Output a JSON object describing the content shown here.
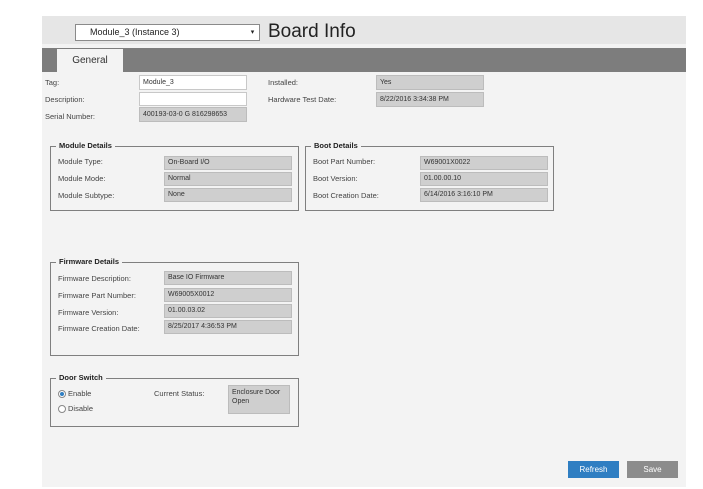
{
  "header": {
    "module_select_value": "Module_3 (Instance 3)",
    "title": "Board Info"
  },
  "tabs": [
    {
      "label": "General",
      "active": true
    }
  ],
  "general": {
    "tag_label": "Tag:",
    "tag_value": "Module_3",
    "description_label": "Description:",
    "description_value": "",
    "serial_label": "Serial Number:",
    "serial_value": "400193-03-0 G 816298653",
    "installed_label": "Installed:",
    "installed_value": "Yes",
    "hw_test_label": "Hardware Test Date:",
    "hw_test_value": "8/22/2016 3:34:38 PM"
  },
  "module_details": {
    "title": "Module Details",
    "rows": [
      {
        "label": "Module Type:",
        "value": "On-Board I/O"
      },
      {
        "label": "Module Mode:",
        "value": "Normal"
      },
      {
        "label": "Module Subtype:",
        "value": "None"
      }
    ]
  },
  "boot_details": {
    "title": "Boot Details",
    "rows": [
      {
        "label": "Boot Part Number:",
        "value": "W69001X0022"
      },
      {
        "label": "Boot Version:",
        "value": "01.00.00.10"
      },
      {
        "label": "Boot Creation Date:",
        "value": "6/14/2016 3:16:10 PM"
      }
    ]
  },
  "firmware_details": {
    "title": "Firmware Details",
    "rows": [
      {
        "label": "Firmware Description:",
        "value": "Base IO Firmware"
      },
      {
        "label": "Firmware Part Number:",
        "value": "W69005X0012"
      },
      {
        "label": "Firmware Version:",
        "value": "01.00.03.02"
      },
      {
        "label": "Firmware Creation Date:",
        "value": "8/25/2017 4:36:53 PM"
      }
    ]
  },
  "door_switch": {
    "title": "Door Switch",
    "enable_label": "Enable",
    "disable_label": "Disable",
    "selected": "Enable",
    "status_label": "Current Status:",
    "status_value": "Enclosure Door Open"
  },
  "buttons": {
    "refresh": "Refresh",
    "save": "Save"
  },
  "colors": {
    "accent": "#2f7ec2",
    "tabbar": "#7d7d7d",
    "readonly_field": "#cfcfcf"
  }
}
